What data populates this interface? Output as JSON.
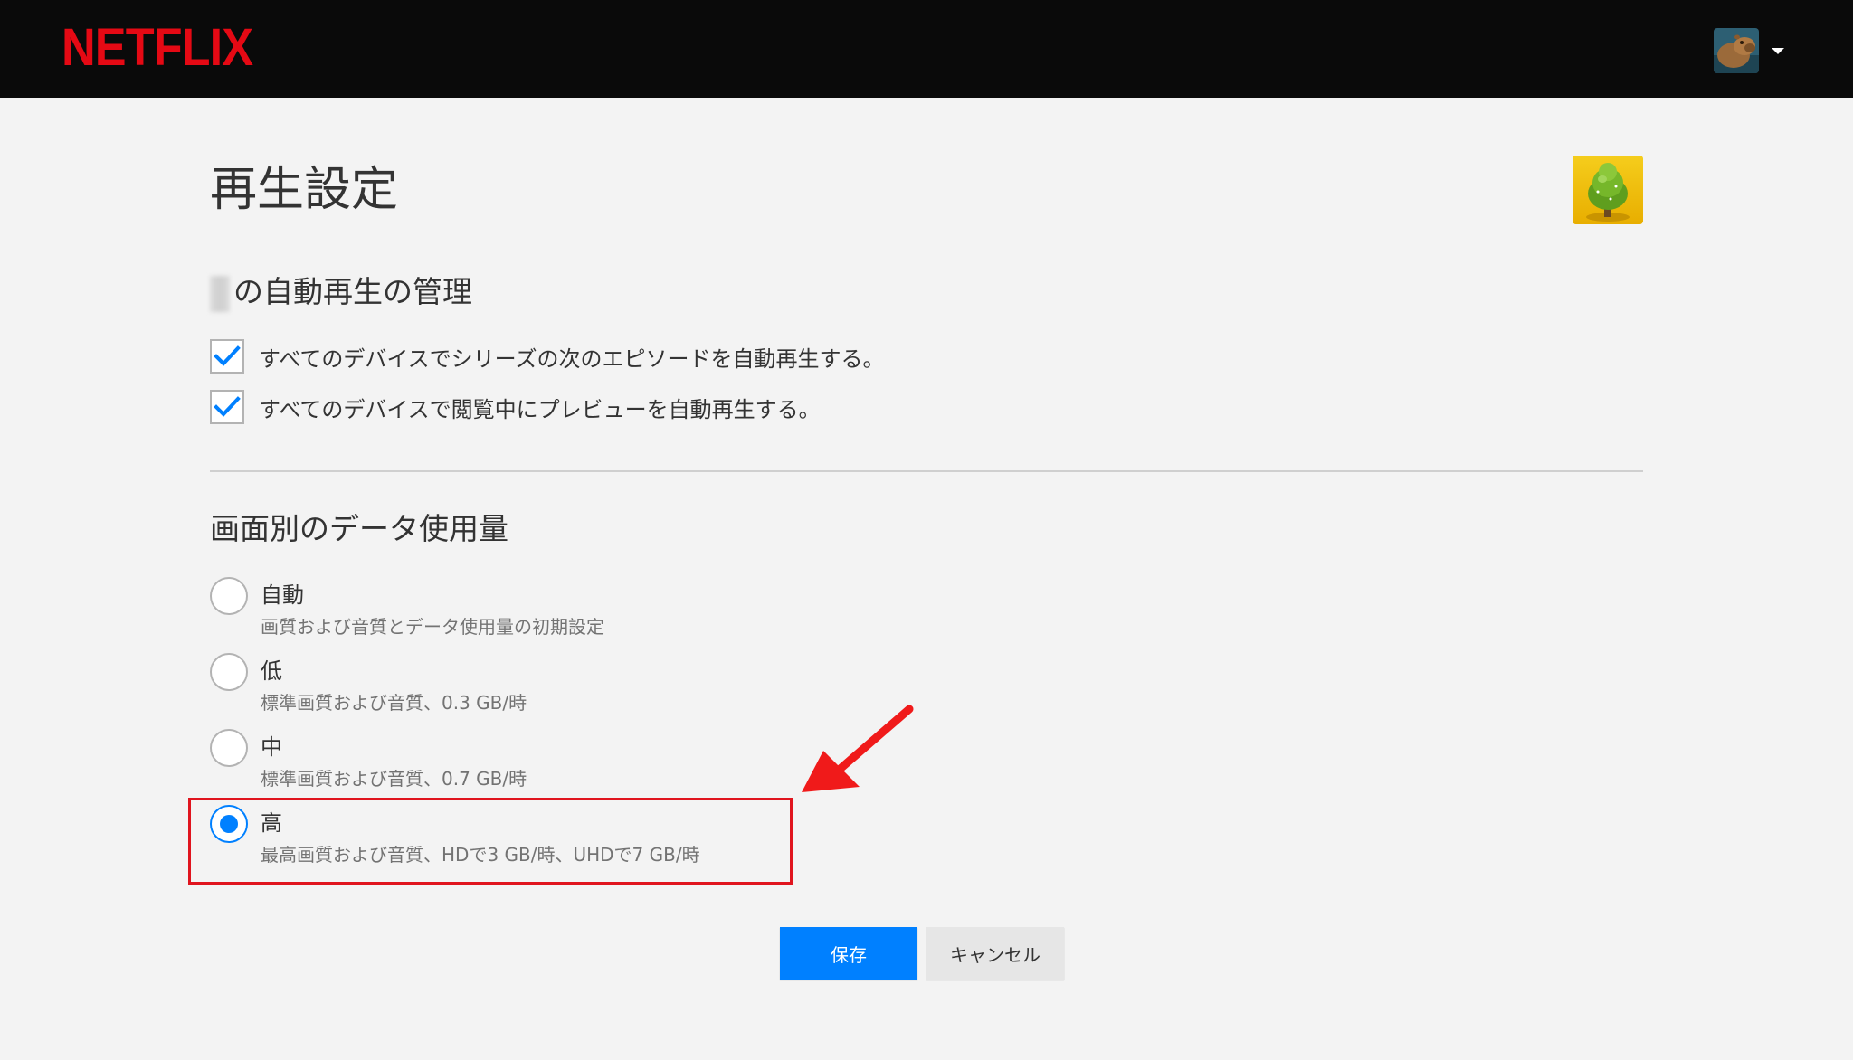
{
  "header": {
    "logo_text": "NETFLIX",
    "account_icon": "caret-down-icon"
  },
  "page": {
    "title": "再生設定"
  },
  "autoplay": {
    "title": "の自動再生の管理",
    "options": [
      {
        "label": "すべてのデバイスでシリーズの次のエピソードを自動再生する。",
        "checked": true
      },
      {
        "label": "すべてのデバイスで閲覧中にプレビューを自動再生する。",
        "checked": true
      }
    ]
  },
  "data_usage": {
    "title": "画面別のデータ使用量",
    "options": [
      {
        "label": "自動",
        "description": "画質および音質とデータ使用量の初期設定",
        "selected": false
      },
      {
        "label": "低",
        "description": "標準画質および音質、0.3 GB/時",
        "selected": false
      },
      {
        "label": "中",
        "description": "標準画質および音質、0.7 GB/時",
        "selected": false
      },
      {
        "label": "高",
        "description": "最高画質および音質、HDで3 GB/時、UHDで7 GB/時",
        "selected": true
      }
    ]
  },
  "buttons": {
    "save": "保存",
    "cancel": "キャンセル"
  },
  "colors": {
    "brand": "#e50914",
    "accent": "#0080ff",
    "annotation": "#e0141e"
  }
}
